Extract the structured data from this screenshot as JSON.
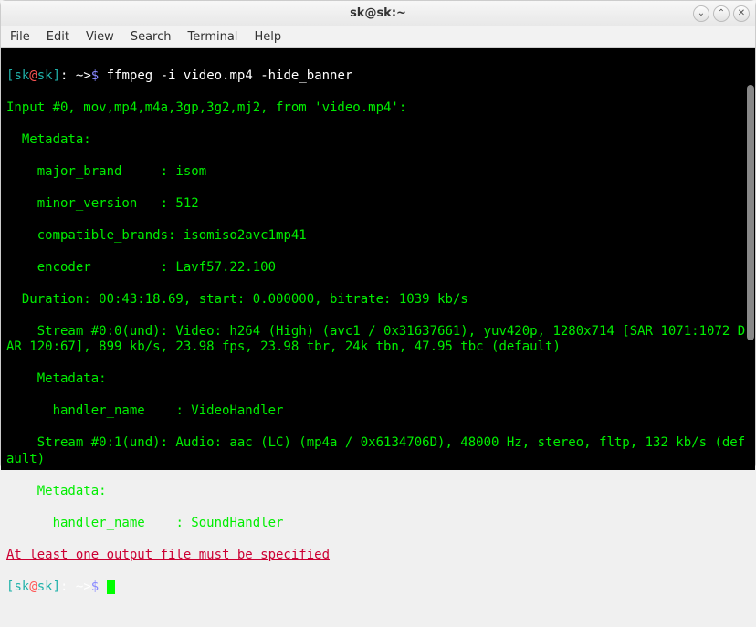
{
  "window": {
    "title": "sk@sk:~"
  },
  "menu": {
    "file": "File",
    "edit": "Edit",
    "view": "View",
    "search": "Search",
    "terminal": "Terminal",
    "help": "Help"
  },
  "prompt": {
    "user": "sk",
    "at": "@",
    "host": "sk",
    "lbr": "[",
    "rbr": "]",
    "colon": ":",
    "path": " ~>",
    "dollar": "$ "
  },
  "command": "ffmpeg -i video.mp4 -hide_banner",
  "output": {
    "l1": "Input #0, mov,mp4,m4a,3gp,3g2,mj2, from 'video.mp4':",
    "l2": "  Metadata:",
    "l3": "    major_brand     : isom",
    "l4": "    minor_version   : 512",
    "l5": "    compatible_brands: isomiso2avc1mp41",
    "l6": "    encoder         : Lavf57.22.100",
    "l7": "  Duration: 00:43:18.69, start: 0.000000, bitrate: 1039 kb/s",
    "l8": "    Stream #0:0(und): Video: h264 (High) (avc1 / 0x31637661), yuv420p, 1280x714 [SAR 1071:1072 DAR 120:67], 899 kb/s, 23.98 fps, 23.98 tbr, 24k tbn, 47.95 tbc (default)",
    "l9": "    Metadata:",
    "l10": "      handler_name    : VideoHandler",
    "l11": "    Stream #0:1(und): Audio: aac (LC) (mp4a / 0x6134706D), 48000 Hz, stereo, fltp, 132 kb/s (default)",
    "l12": "    Metadata:",
    "l13": "      handler_name    : SoundHandler"
  },
  "error": "At least one output file must be specified",
  "icons": {
    "minimize": "⌄",
    "maximize": "⌃",
    "close": "✕"
  }
}
